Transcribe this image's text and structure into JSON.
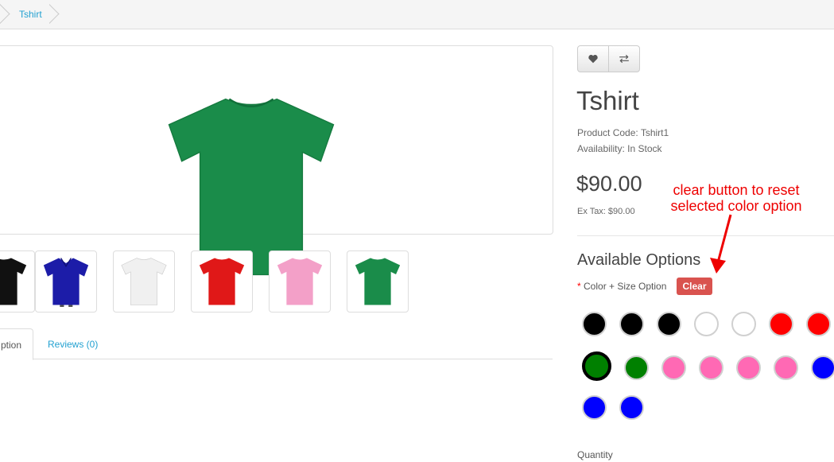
{
  "breadcrumb": {
    "items": [
      "Tshirt"
    ]
  },
  "product": {
    "title": "Tshirt",
    "code_line": "Product Code: Tshirt1",
    "availability_line": "Availability: In Stock",
    "price": "$90.00",
    "ex_tax": "Ex Tax: $90.00",
    "main_image_color": "#1a8c4a"
  },
  "thumbnails": [
    {
      "color": "#111111",
      "kind": "tee"
    },
    {
      "color": "#1c1ca8",
      "kind": "polo"
    },
    {
      "color": "#eeeeee",
      "kind": "tee"
    },
    {
      "color": "#e01818",
      "kind": "tee"
    },
    {
      "color": "#f3a0c8",
      "kind": "tee"
    },
    {
      "color": "#1a8c4a",
      "kind": "tee"
    }
  ],
  "tabs": {
    "active_label": "ption",
    "reviews_label": "Reviews (0)"
  },
  "options": {
    "heading": "Available Options",
    "required_mark": "*",
    "label": "Color + Size Option",
    "clear_label": "Clear",
    "swatches": [
      "#000000",
      "#000000",
      "#000000",
      "#ffffff",
      "#ffffff",
      "#ff0000",
      "#ff0000",
      "#008000",
      "#008000",
      "#ff69b4",
      "#ff69b4",
      "#ff69b4",
      "#ff69b4",
      "#0000ff",
      "#0000ff",
      "#0000ff"
    ],
    "selected_index": 7
  },
  "annotation": {
    "line1": "clear button to reset",
    "line2": "selected color option"
  },
  "quantity_label": "Quantity",
  "icons": {
    "wishlist": "heart-icon",
    "compare": "exchange-icon"
  }
}
